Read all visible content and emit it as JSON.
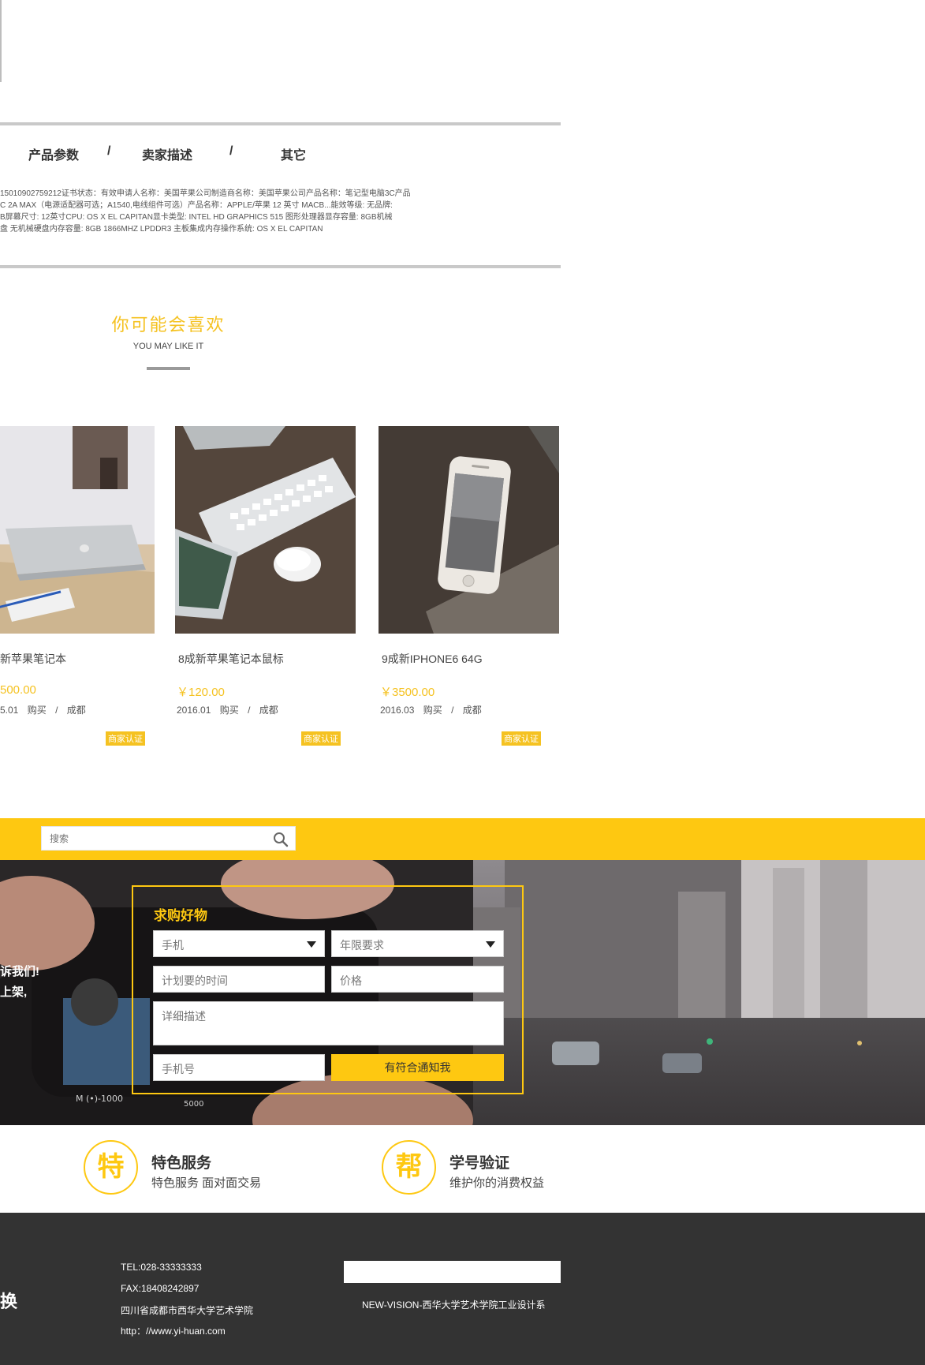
{
  "tabs": [
    {
      "label": "产品参数"
    },
    {
      "label": "卖家描述"
    },
    {
      "label": "其它"
    }
  ],
  "tab_separator": "/",
  "params_lines": [
    "15010902759212证书状态：有效申请人名称：美国苹果公司制造商名称：美国苹果公司产品名称：笔记型电脑3C产品",
    "C 2A MAX（电源适配器可选；A1540,电线组件可选）产品名称：APPLE/苹果 12 英寸 MACB...能效等级: 无品牌:",
    "B屏幕尺寸: 12英寸CPU: OS X EL CAPITAN显卡类型: INTEL HD GRAPHICS 515 图形处理器显存容量: 8GB机械",
    "盘 无机械硬盘内存容量: 8GB 1866MHZ LPDDR3 主板集成内存操作系统: OS X EL CAPITAN"
  ],
  "recommend": {
    "title": "你可能会喜欢",
    "subtitle": "YOU MAY LIKE IT"
  },
  "products": [
    {
      "name": "新苹果笔记本",
      "price": "500.00",
      "date": "5.01",
      "buy": "购买",
      "sep": "/",
      "city": "成都",
      "badge": "商家认证",
      "image": "laptop-on-desk-photo"
    },
    {
      "name": "8成新苹果笔记本鼠标",
      "price": "￥120.00",
      "date": "2016.01",
      "buy": "购买",
      "sep": "/",
      "city": "成都",
      "badge": "商家认证",
      "image": "keyboard-mouse-ipad-photo"
    },
    {
      "name": "9成新IPHONE6 64G",
      "price": "￥3500.00",
      "date": "2016.03",
      "buy": "购买",
      "sep": "/",
      "city": "成都",
      "badge": "商家认证",
      "image": "iphone-on-table-photo"
    }
  ],
  "search": {
    "placeholder": "搜索",
    "icon": "search-icon"
  },
  "hero": {
    "side_text_1": "诉我们!",
    "side_text_2": "上架,"
  },
  "request_form": {
    "title": "求购好物",
    "category_select": "手机",
    "years_select": "年限要求",
    "time_placeholder": "计划要的时间",
    "price_placeholder": "价格",
    "detail_placeholder": "详细描述",
    "phone_placeholder": "手机号",
    "submit_label": "有符合通知我"
  },
  "features": [
    {
      "glyph": "特",
      "title": "特色服务",
      "desc": "特色服务 面对面交易"
    },
    {
      "glyph": "帮",
      "title": "学号验证",
      "desc": "维护你的消费权益"
    }
  ],
  "footer": {
    "brand_fragment": "换",
    "tel": "TEL:028-33333333",
    "fax": "FAX:18408242897",
    "address": "四川省成都市西华大学艺术学院",
    "url": "http：//www.yi-huan.com",
    "note": "NEW-VISION-西华大学艺术学院工业设计系"
  },
  "colors": {
    "accent": "#fec811",
    "footer_bg": "#333333"
  }
}
